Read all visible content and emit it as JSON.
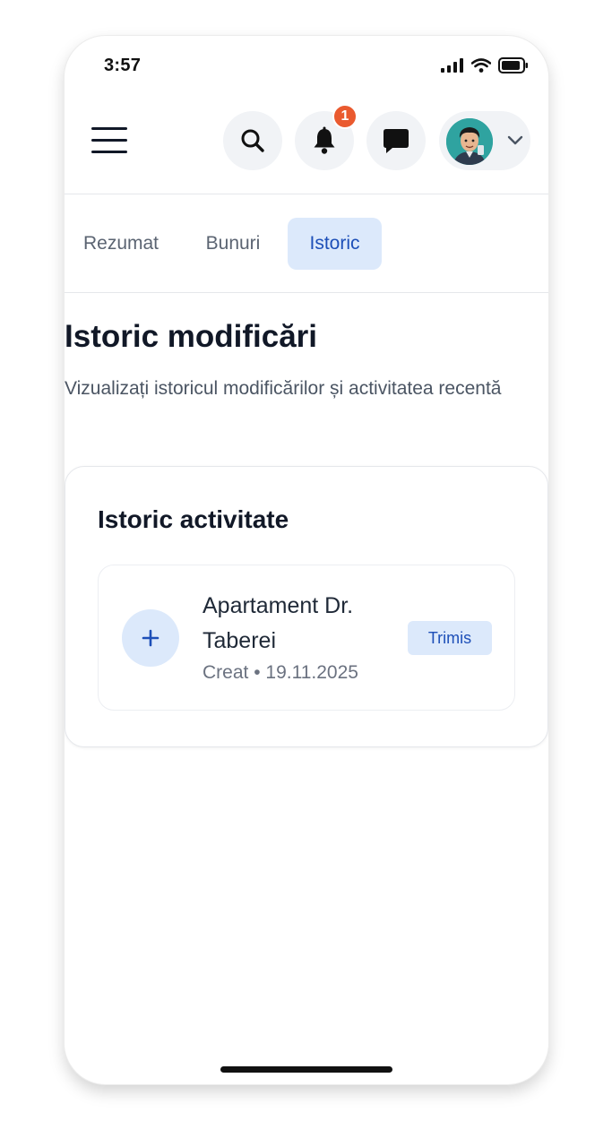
{
  "status_bar": {
    "time": "3:57",
    "icons": [
      "signal-icon",
      "wifi-icon",
      "battery-icon"
    ]
  },
  "header": {
    "menu_icon": "hamburger-menu-icon",
    "search_icon": "search-icon",
    "notifications_icon": "bell-icon",
    "notifications_count": "1",
    "messages_icon": "chat-icon",
    "profile_chevron_icon": "chevron-down-icon"
  },
  "tabs": [
    {
      "label": "Rezumat",
      "active": false
    },
    {
      "label": "Bunuri",
      "active": false
    },
    {
      "label": "Istoric",
      "active": true
    }
  ],
  "page": {
    "title": "Istoric modificări",
    "subtitle": "Vizualizați istoricul modificărilor și activitatea recentă"
  },
  "activity_card": {
    "title": "Istoric activitate",
    "items": [
      {
        "icon": "plus-icon",
        "title": "Apartament Dr. Taberei",
        "action": "Creat",
        "separator": "•",
        "date": "19.11.2025",
        "status": "Trimis"
      }
    ]
  },
  "colors": {
    "accent": "#1d4fb8",
    "accent_light": "#dce9fb",
    "badge": "#ea5a2f",
    "text_primary": "#111827",
    "text_secondary": "#6b7280"
  }
}
